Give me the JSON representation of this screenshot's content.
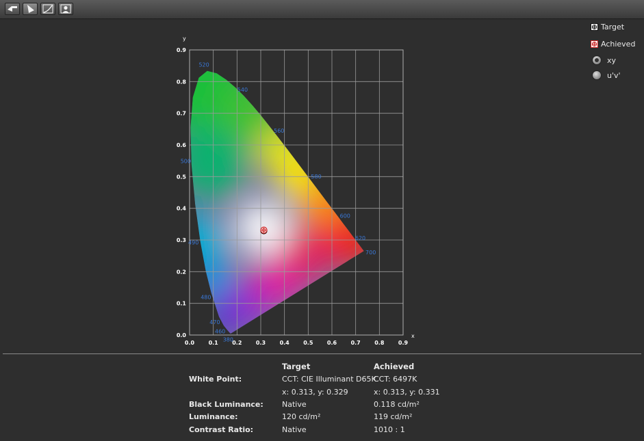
{
  "toolbar": {
    "buttons": [
      {
        "name": "back-button",
        "icon": "back-arrow-icon"
      },
      {
        "name": "gamut-view-button",
        "icon": "gamut-icon",
        "active": true
      },
      {
        "name": "curve-view-button",
        "icon": "curve-icon"
      },
      {
        "name": "profile-view-button",
        "icon": "person-icon"
      }
    ]
  },
  "legend": {
    "target_label": "Target",
    "achieved_label": "Achieved",
    "radio_xy": "xy",
    "radio_uv": "u'v'",
    "selected": "xy",
    "target_marker_color": "#ffffff",
    "achieved_marker_color": "#cc2020"
  },
  "chart_data": {
    "type": "scatter",
    "xlabel": "x",
    "ylabel": "y",
    "xlim": [
      0.0,
      0.9
    ],
    "ylim": [
      0.0,
      0.9
    ],
    "xticks": [
      "0.0",
      "0.1",
      "0.2",
      "0.3",
      "0.4",
      "0.5",
      "0.6",
      "0.7",
      "0.8",
      "0.9"
    ],
    "yticks": [
      "0.0",
      "0.1",
      "0.2",
      "0.3",
      "0.4",
      "0.5",
      "0.6",
      "0.7",
      "0.8",
      "0.9"
    ],
    "grid": true,
    "wavelength_labels": [
      {
        "label": "380",
        "x": 0.175,
        "y": 0.005
      },
      {
        "label": "460",
        "x": 0.144,
        "y": 0.03
      },
      {
        "label": "470",
        "x": 0.124,
        "y": 0.058
      },
      {
        "label": "480",
        "x": 0.091,
        "y": 0.133
      },
      {
        "label": "490",
        "x": 0.045,
        "y": 0.295
      },
      {
        "label": "500",
        "x": 0.008,
        "y": 0.538
      },
      {
        "label": "520",
        "x": 0.074,
        "y": 0.834
      },
      {
        "label": "540",
        "x": 0.23,
        "y": 0.754
      },
      {
        "label": "560",
        "x": 0.373,
        "y": 0.624
      },
      {
        "label": "580",
        "x": 0.512,
        "y": 0.487
      },
      {
        "label": "600",
        "x": 0.627,
        "y": 0.373
      },
      {
        "label": "620",
        "x": 0.691,
        "y": 0.308
      },
      {
        "label": "700",
        "x": 0.735,
        "y": 0.265
      }
    ],
    "series": [
      {
        "name": "Target",
        "points": [
          {
            "x": 0.313,
            "y": 0.329
          }
        ]
      },
      {
        "name": "Achieved",
        "points": [
          {
            "x": 0.313,
            "y": 0.331
          }
        ]
      }
    ]
  },
  "table": {
    "col_target": "Target",
    "col_achieved": "Achieved",
    "rows": [
      {
        "label": "White Point:",
        "target": "CCT: CIE Illuminant D65K",
        "achieved": "CCT: 6497K"
      },
      {
        "label": "",
        "target": "x: 0.313, y: 0.329",
        "achieved": "x: 0.313, y: 0.331"
      },
      {
        "label": "Black Luminance:",
        "target": "Native",
        "achieved": "0.118 cd/m²"
      },
      {
        "label": "Luminance:",
        "target": "120 cd/m²",
        "achieved": "119 cd/m²"
      },
      {
        "label": "Contrast Ratio:",
        "target": "Native",
        "achieved": "1010 : 1"
      }
    ]
  }
}
